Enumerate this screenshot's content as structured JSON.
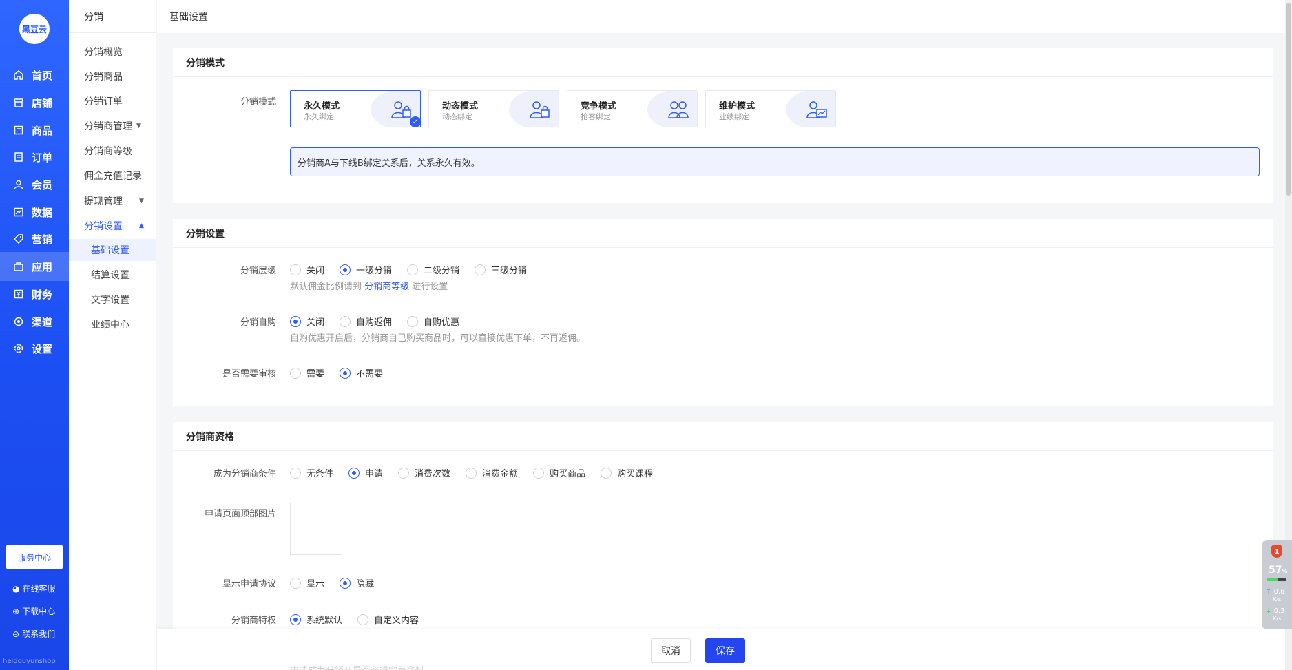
{
  "brand": {
    "logo_text": "黑豆云",
    "watermark": "heidouyunshop"
  },
  "main_nav": [
    {
      "label": "首页",
      "icon": "home-icon"
    },
    {
      "label": "店铺",
      "icon": "store-icon"
    },
    {
      "label": "商品",
      "icon": "goods-icon"
    },
    {
      "label": "订单",
      "icon": "order-icon"
    },
    {
      "label": "会员",
      "icon": "member-icon"
    },
    {
      "label": "数据",
      "icon": "data-icon"
    },
    {
      "label": "营销",
      "icon": "tag-icon"
    },
    {
      "label": "应用",
      "icon": "app-icon"
    },
    {
      "label": "财务",
      "icon": "finance-icon"
    },
    {
      "label": "渠道",
      "icon": "channel-icon"
    },
    {
      "label": "设置",
      "icon": "gear-icon"
    }
  ],
  "service_center": "服务中心",
  "footer_links": [
    {
      "label": "在线客服",
      "icon": "avatar-icon"
    },
    {
      "label": "下载中心",
      "icon": "download-icon"
    },
    {
      "label": "联系我们",
      "icon": "chat-icon"
    }
  ],
  "sub_nav": {
    "title": "分销",
    "items": [
      "分销概览",
      "分销商品",
      "分销订单",
      "分销商管理",
      "分销商等级",
      "佣金充值记录",
      "提现管理",
      "分销设置"
    ],
    "children": [
      "基础设置",
      "结算设置",
      "文字设置",
      "业绩中心"
    ]
  },
  "breadcrumb": "基础设置",
  "mode_section": {
    "title": "分销模式",
    "label": "分销模式",
    "cards": [
      {
        "title": "永久模式",
        "sub": "永久绑定",
        "icon": "user-lock-icon",
        "selected": true
      },
      {
        "title": "动态模式",
        "sub": "动态绑定",
        "icon": "user-lock-icon",
        "selected": false
      },
      {
        "title": "竞争模式",
        "sub": "抢客绑定",
        "icon": "users-icon",
        "selected": false
      },
      {
        "title": "维护模式",
        "sub": "业绩绑定",
        "icon": "user-chart-icon",
        "selected": false
      }
    ],
    "description": "分销商A与下线B绑定关系后，关系永久有效。"
  },
  "settings_section": {
    "title": "分销设置",
    "level": {
      "label": "分销层级",
      "options": [
        "关闭",
        "一级分销",
        "二级分销",
        "三级分销"
      ],
      "selected": 1,
      "hint_prefix": "默认佣金比例请到",
      "hint_link": "分销商等级",
      "hint_suffix": "进行设置"
    },
    "self_buy": {
      "label": "分销自购",
      "options": [
        "关闭",
        "自购返佣",
        "自购优惠"
      ],
      "selected": 0,
      "hint": "自购优惠开启后，分销商自己购买商品时，可以直接优惠下单，不再返佣。"
    },
    "audit": {
      "label": "是否需要审核",
      "options": [
        "需要",
        "不需要"
      ],
      "selected": 1
    }
  },
  "qualify_section": {
    "title": "分销商资格",
    "condition": {
      "label": "成为分销商条件",
      "options": [
        "无条件",
        "申请",
        "消费次数",
        "消费金额",
        "购买商品",
        "购买课程"
      ],
      "selected": 1
    },
    "top_image": {
      "label": "申请页面顶部图片"
    },
    "agreement": {
      "label": "显示申请协议",
      "options": [
        "显示",
        "隐藏"
      ],
      "selected": 1
    },
    "privilege": {
      "label": "分销商特权",
      "options": [
        "系统默认",
        "自定义内容"
      ],
      "selected": 0
    },
    "faded_text": "申请成为分销商是否必须完善资料"
  },
  "actions": {
    "cancel": "取消",
    "save": "保存"
  },
  "widget": {
    "badge": "1",
    "percent": "57",
    "unit": "%",
    "up": "0.6",
    "down": "0.3",
    "speed_unit": "K/s"
  },
  "colors": {
    "primary": "#2f5bff",
    "nav_bg": "#1c4ff3",
    "save_bg": "#2545f0"
  }
}
